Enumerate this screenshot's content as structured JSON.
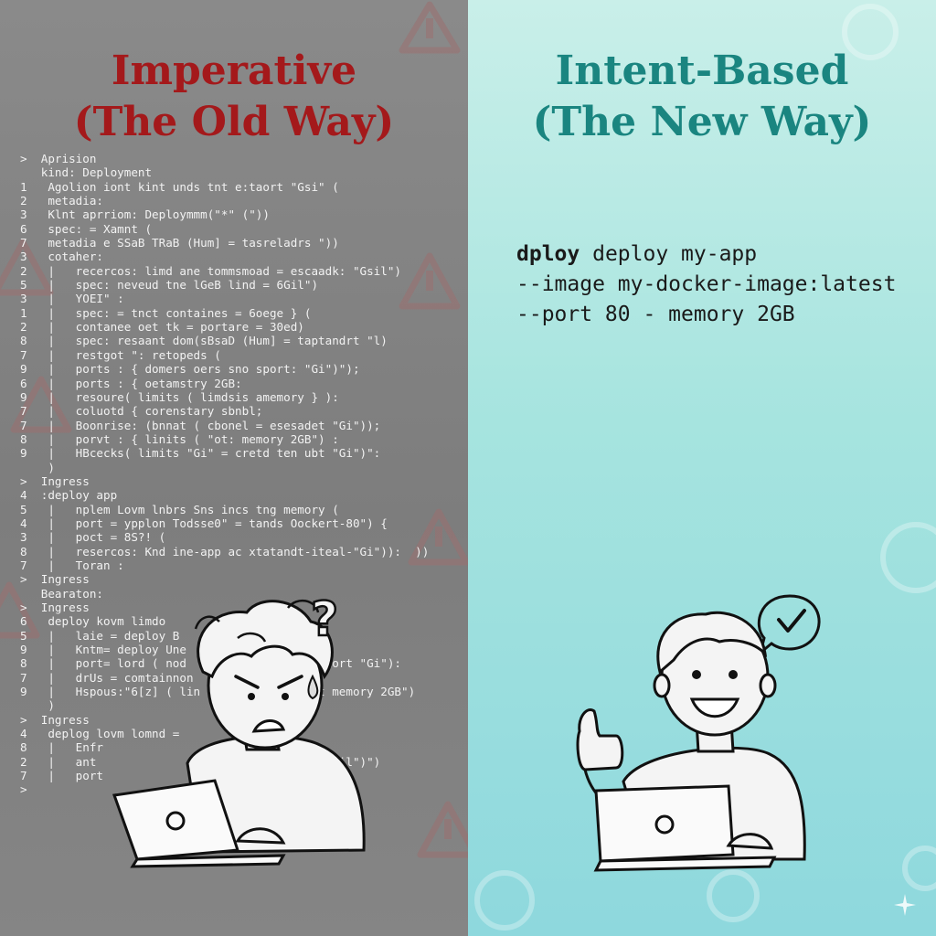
{
  "left": {
    "title_line1": "Imperative",
    "title_line2": "(The Old Way)",
    "code_lines": [
      ">  Aprision",
      "   kind: Deployment",
      "1   Agolion iont kint unds tnt e:taort \"Gsi\" (",
      "2   metadia:",
      "3   Klnt aprriom: Deploymmm(\"*\" (\"))",
      "6   spec: = Xamnt (",
      "7   metadia e SSaB TRaB (Hum] = tasreladrs \"))",
      "3   cotaher:",
      "2   |   recercos: limd ane tommsmoad = escaadk: \"Gsil\")",
      "5   |   spec: neveud tne lGeB lind = 6Gil\")",
      "3   |   YOEI\" :",
      "1   |   spec: = tnct containes = 6oege } (",
      "2   |   contanee oet tk = portare = 30ed)",
      "8   |   spec: resaant dom(sBsaD (Hum] = taptandrt \"l)",
      "7   |   restgot \": retopeds (",
      "9   |   ports : { domers oers sno sport: \"Gi\")\");",
      "6   |   ports : { oetamstry 2GB:",
      "9   |   resoure( limits ( limdsis amemory } ):",
      "7   |   coluotd { corenstary sbnbl;",
      "7   |   Boonrise: (bnnat ( cbonel = esesadet \"Gi\"));",
      "8   |   porvt : { linits ( \"ot: memory 2GB\") :",
      "9   |   HBcecks( limits \"Gi\" = cretd ten ubt \"Gi\")\":",
      "    )",
      ">  Ingress",
      "4  :deploy app",
      "5   |   nplem Lovm lnbrs Sns incs tng memory (",
      "4   |   port = ypplon Todsse0\" = tands Oockert-80\") {",
      "3   |   poct = 8S?! (",
      "8   |   resercos: Knd ine-app ac xtatandt-iteal-\"Gi\")):  ))",
      "7   |   Toran :",
      ">  Ingress",
      "   Bearaton:",
      ">  Ingress",
      "6   deploy kovm limdo",
      "5   |   laie = deploy B",
      "9   |   Kntm= deploy Une",
      "8   |   port= lord ( nod                   taort \"Gi\"):",
      "7   |   drUs = comtainnon",
      "9   |   Hspous:\"6[z] ( lin              etat memory 2GB\")",
      "    )",
      ">  Ingress",
      "4   deplog lovm lomnd =",
      "8   |   Enfr",
      "2   |   ant                             or: 2oil\")\")",
      "7   |   port",
      ">"
    ]
  },
  "right": {
    "title_line1": "Intent-Based",
    "title_line2": "(The New Way)",
    "cmd_keyword": "dploy",
    "cmd_line1_rest": " deploy my-app",
    "cmd_line2": "--image my-docker-image:latest",
    "cmd_line3": "--port 80 - memory 2GB"
  },
  "icons": [
    "warning-icon",
    "question-mark-icon",
    "check-bubble-icon",
    "gear-icon",
    "sparkle-icon",
    "laptop-icon",
    "thumbs-up-icon"
  ]
}
